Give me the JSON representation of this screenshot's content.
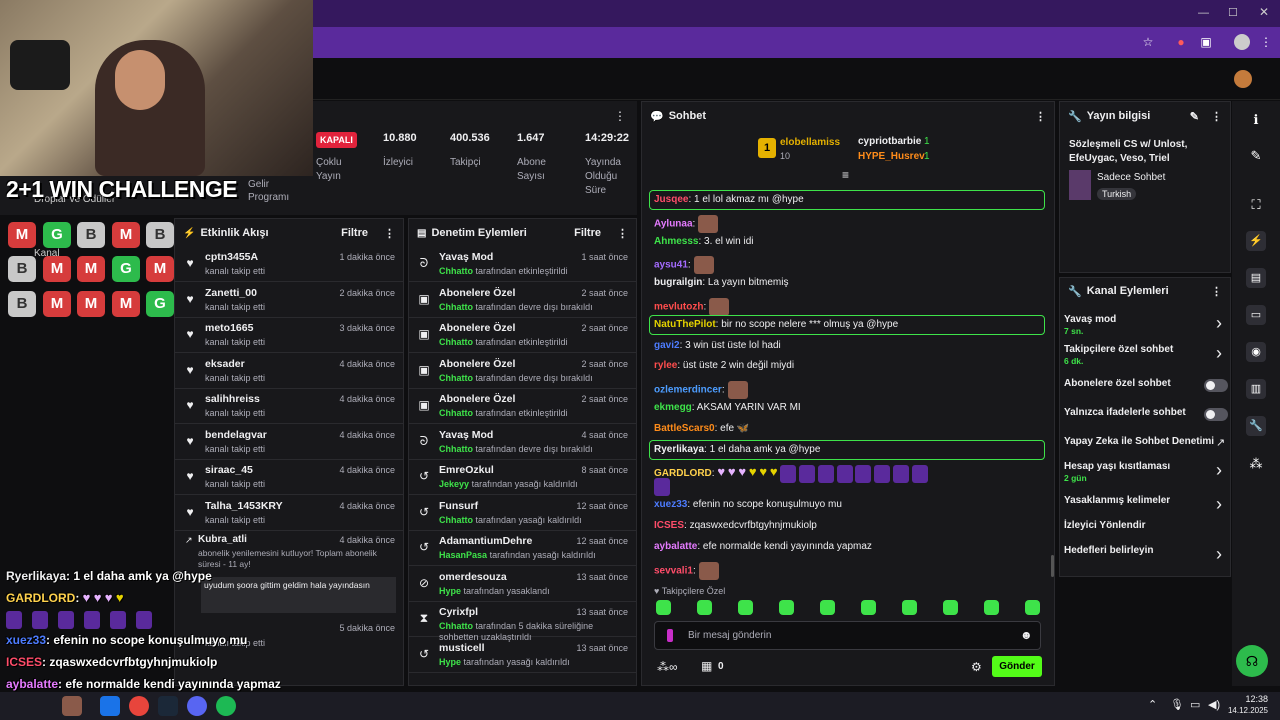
{
  "stream_stats": [
    {
      "value": "KAPALI",
      "label": "Çoklu Yayın"
    },
    {
      "value": "10.880",
      "label": "İzleyici"
    },
    {
      "value": "400.536",
      "label": "Takipçi"
    },
    {
      "value": "1.647",
      "label": "Abone Sayısı"
    },
    {
      "value": "14:29:22",
      "label": "Yayında Olduğu Süre"
    }
  ],
  "gelir_label": "Gelir Programı",
  "droplar_label": "Droplar ve Ödüller",
  "kanal_label": "Kanal",
  "challenge_text": "2+1 WIN CHALLENGE",
  "tiles": [
    [
      "M",
      "G",
      "B",
      "M",
      "B"
    ],
    [
      "B",
      "M",
      "M",
      "G",
      "M"
    ],
    [
      "B",
      "M",
      "M",
      "M",
      "G"
    ]
  ],
  "activity": {
    "title": "Etkinlik Akışı",
    "filter": "Filtre",
    "items": [
      {
        "name": "cptn3455A",
        "sub": "kanalı takip etti",
        "time": "1 dakika önce"
      },
      {
        "name": "Zanetti_00",
        "sub": "kanalı takip etti",
        "time": "2 dakika önce"
      },
      {
        "name": "meto1665",
        "sub": "kanalı takip etti",
        "time": "3 dakika önce"
      },
      {
        "name": "eksader",
        "sub": "kanalı takip etti",
        "time": "4 dakika önce"
      },
      {
        "name": "salihhreiss",
        "sub": "kanalı takip etti",
        "time": "4 dakika önce"
      },
      {
        "name": "bendelagvar",
        "sub": "kanalı takip etti",
        "time": "4 dakika önce"
      },
      {
        "name": "siraac_45",
        "sub": "kanalı takip etti",
        "time": "4 dakika önce"
      },
      {
        "name": "Talha_1453KRY",
        "sub": "kanalı takip etti",
        "time": "4 dakika önce"
      }
    ],
    "sub_item": {
      "name": "Kubra_atli",
      "time": "4 dakika önce",
      "text": "abonelik yenilemesini kutluyor! Toplam abonelik süresi - 11 ay!",
      "msg": "uyudum şoora gittim geldim hala yayındasın"
    },
    "tail": {
      "time": "5 dakika önce",
      "sub": "kanalı takip etti",
      "time2": "5 dakika önce"
    }
  },
  "moderation": {
    "title": "Denetim Eylemleri",
    "filter": "Filtre",
    "items": [
      {
        "name": "Yavaş Mod",
        "by": "Chhatto",
        "rest": "tarafından etkinleştirildi",
        "time": "1 saat önce",
        "icon": "snail-icon"
      },
      {
        "name": "Abonelere Özel",
        "by": "Chhatto",
        "rest": "tarafından devre dışı bırakıldı",
        "time": "2 saat önce",
        "icon": "gift-icon"
      },
      {
        "name": "Abonelere Özel",
        "by": "Chhatto",
        "rest": "tarafından etkinleştirildi",
        "time": "2 saat önce",
        "icon": "gift-icon"
      },
      {
        "name": "Abonelere Özel",
        "by": "Chhatto",
        "rest": "tarafından devre dışı bırakıldı",
        "time": "2 saat önce",
        "icon": "gift-icon"
      },
      {
        "name": "Abonelere Özel",
        "by": "Chhatto",
        "rest": "tarafından etkinleştirildi",
        "time": "2 saat önce",
        "icon": "gift-icon"
      },
      {
        "name": "Yavaş Mod",
        "by": "Chhatto",
        "rest": "tarafından devre dışı bırakıldı",
        "time": "4 saat önce",
        "icon": "snail-icon"
      },
      {
        "name": "EmreOzkul",
        "by": "Jekeyy",
        "rest": "tarafından yasağı kaldırıldı",
        "time": "8 saat önce",
        "icon": "undo-icon"
      },
      {
        "name": "Funsurf",
        "by": "Chhatto",
        "rest": "tarafından yasağı kaldırıldı",
        "time": "12 saat önce",
        "icon": "undo-icon"
      },
      {
        "name": "AdamantiumDehre",
        "by": "HasanPasa",
        "rest": "tarafından yasağı kaldırıldı",
        "time": "12 saat önce",
        "icon": "undo-icon"
      },
      {
        "name": "omerdesouza",
        "by": "Hype",
        "rest": "tarafından yasaklandı",
        "time": "13 saat önce",
        "icon": "ban-icon"
      },
      {
        "name": "Cyrixfpl",
        "by": "Chhatto",
        "rest": "tarafından 5 dakika süreliğine sohbetten uzaklaştırıldı",
        "time": "13 saat önce",
        "icon": "hourglass-icon"
      },
      {
        "name": "musticell",
        "by": "Hype",
        "rest": "tarafından yasağı kaldırıldı",
        "time": "13 saat önce",
        "icon": "undo-icon"
      }
    ]
  },
  "chat": {
    "title": "Sohbet",
    "top": [
      {
        "rank": "1",
        "name": "elobellamiss",
        "count": "10"
      },
      {
        "rank": "",
        "name": "cypriotbarbie",
        "count": "1"
      },
      {
        "rank": "",
        "name": "HYPE_Husrev",
        "count": "1"
      }
    ],
    "messages": [
      {
        "user": "Jusqee",
        "color": "#ff4d6a",
        "text": ": 1 el lol akmaz mı @hype",
        "hl": true
      },
      {
        "user": "Aylunaa",
        "color": "#e57bff",
        "text": ":",
        "emote": 1
      },
      {
        "user": "Ahmesss",
        "color": "#3ee34a",
        "text": ": 3. el win idi"
      },
      {
        "user": "aysu41",
        "color": "#a46bff",
        "text": ":",
        "emote": 1
      },
      {
        "user": "bugrailgin",
        "color": "#efeff1",
        "text": ": La yayın bitmemiş"
      },
      {
        "user": "mevlutozh",
        "color": "#ff4d4d",
        "text": ":",
        "emote": 1
      },
      {
        "user": "NatuThePilot",
        "color": "#e5d300",
        "text": ": bir no scope nelere *** olmuş ya @hype",
        "hl": true
      },
      {
        "user": "gavi2",
        "color": "#4d7cff",
        "text": ": 3 win üst üste lol hadi"
      },
      {
        "user": "rylee",
        "color": "#ff4d4d",
        "text": ": üst üste 2 win değil miydi"
      },
      {
        "user": "ozlemerdincer",
        "color": "#4d9dff",
        "text": ":",
        "emote": 1
      },
      {
        "user": "ekmegg",
        "color": "#3ee34a",
        "text": ": AKSAM YARIN VAR MI"
      },
      {
        "user": "BattleScars0",
        "color": "#ff8c1a",
        "text": ": efe"
      },
      {
        "user": "Ryerlikaya",
        "color": "#efeff1",
        "text": ": 1 el daha amk ya @hype",
        "hl": true
      },
      {
        "user": "GARDLORD",
        "color": "#ffd24d",
        "text": ":"
      },
      {
        "user": "xuez33",
        "color": "#4d7cff",
        "text": ": efenin no scope konuşulmuyo mu"
      },
      {
        "user": "ICSES",
        "color": "#ff4d6a",
        "text": ": zqaswxedcvrfbtgyhnjmukiolp"
      },
      {
        "user": "aybalatte",
        "color": "#e57bff",
        "text": ": efe normalde kendi yayınında yapmaz"
      },
      {
        "user": "sevvali1",
        "color": "#ff4d6a",
        "text": ":",
        "emote": 1
      }
    ],
    "followers_only": "Takipçilere Özel",
    "input_placeholder": "Bir mesaj gönderin",
    "points": "0",
    "send": "Gönder"
  },
  "stream_info": {
    "title": "Yayın bilgisi",
    "stream_title": "Sözleşmeli CS w/ Unlost, EfeUygac, Veso, Triel",
    "category": "Sadece Sohbet",
    "language": "Turkish"
  },
  "channel_actions": {
    "title": "Kanal Eylemleri",
    "items": [
      {
        "label": "Yavaş mod",
        "sub": "7 sn.",
        "kind": "chev"
      },
      {
        "label": "Takipçilere özel sohbet",
        "sub": "6 dk.",
        "kind": "chev"
      },
      {
        "label": "Abonelere özel sohbet",
        "sub": "",
        "kind": "toggle"
      },
      {
        "label": "Yalnızca ifadelerle sohbet",
        "sub": "",
        "kind": "toggle"
      },
      {
        "label": "Yapay Zeka ile Sohbet Denetimi",
        "sub": "",
        "kind": "ext"
      },
      {
        "label": "Hesap yaşı kısıtlaması",
        "sub": "2 gün",
        "kind": "chev"
      },
      {
        "label": "Yasaklanmış kelimeler",
        "sub": "",
        "kind": "chev"
      },
      {
        "label": "İzleyici Yönlendir",
        "sub": "",
        "kind": "none"
      },
      {
        "label": "Hedefleri belirleyin",
        "sub": "",
        "kind": "chev"
      }
    ]
  },
  "overlay_chat": [
    {
      "user": "Ryerlikaya",
      "text": ": 1 el daha amk ya @hype",
      "color": "#efeff1"
    },
    {
      "user": "GARDLORD",
      "text": ":",
      "color": "#ffd24d"
    },
    {
      "user": "xuez33",
      "text": ": efenin no scope konuşulmuyo mu",
      "color": "#4d7cff"
    },
    {
      "user": "ICSES",
      "text": ": zqaswxedcvrfbtgyhnjmukiolp",
      "color": "#ff4d6a"
    },
    {
      "user": "aybalatte",
      "text": ": efe normalde kendi yayınında yapmaz",
      "color": "#e57bff"
    },
    {
      "user": "sevvali1",
      "text": "",
      "color": "#ff4d6a"
    }
  ],
  "clock": {
    "time": "12:38",
    "date": "14.12.2025"
  },
  "colors": {
    "accent": "#53fc18",
    "purple": "#5a2a9c",
    "panel": "#18181b"
  }
}
